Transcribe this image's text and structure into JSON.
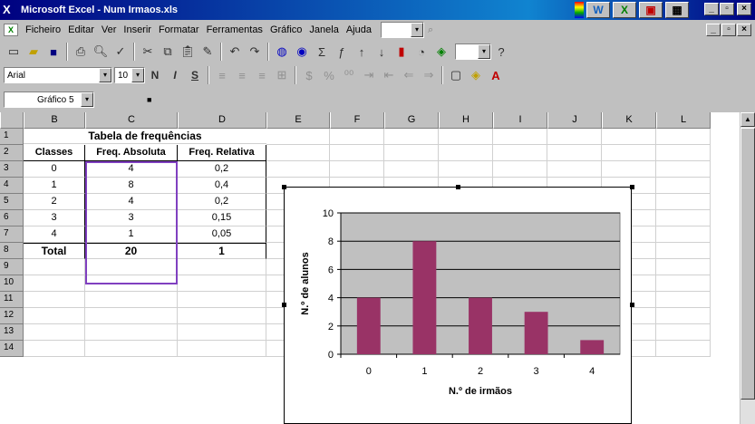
{
  "window": {
    "title": "Microsoft Excel - Num Irmaos.xls"
  },
  "menu": [
    "Ficheiro",
    "Editar",
    "Ver",
    "Inserir",
    "Formatar",
    "Ferramentas",
    "Gráfico",
    "Janela",
    "Ajuda"
  ],
  "toolbar": {
    "font": "Arial",
    "size": "10",
    "bold": "N",
    "italic": "I",
    "underline": "S"
  },
  "namebox": "Gráfico 5",
  "columns": [
    "B",
    "C",
    "D",
    "E",
    "F",
    "G",
    "H",
    "I",
    "J",
    "K",
    "L"
  ],
  "rows": [
    "1",
    "2",
    "3",
    "4",
    "5",
    "6",
    "7",
    "8",
    "9",
    "10",
    "11",
    "12",
    "13",
    "14"
  ],
  "table": {
    "title": "Tabela de frequências",
    "headers": [
      "Classes",
      "Freq. Absoluta",
      "Freq. Relativa"
    ],
    "rows": [
      [
        "0",
        "4",
        "0,2"
      ],
      [
        "1",
        "8",
        "0,4"
      ],
      [
        "2",
        "4",
        "0,2"
      ],
      [
        "3",
        "3",
        "0,15"
      ],
      [
        "4",
        "1",
        "0,05"
      ]
    ],
    "total": [
      "Total",
      "20",
      "1"
    ]
  },
  "chart_data": {
    "type": "bar",
    "categories": [
      "0",
      "1",
      "2",
      "3",
      "4"
    ],
    "values": [
      4,
      8,
      4,
      3,
      1
    ],
    "xlabel": "N.º de irmãos",
    "ylabel": "N.º de alunos",
    "ylim": [
      0,
      10
    ],
    "yticks": [
      "0",
      "2",
      "4",
      "6",
      "8",
      "10"
    ],
    "bar_color": "#993366",
    "plot_bg": "#c0c0c0",
    "grid": true
  }
}
